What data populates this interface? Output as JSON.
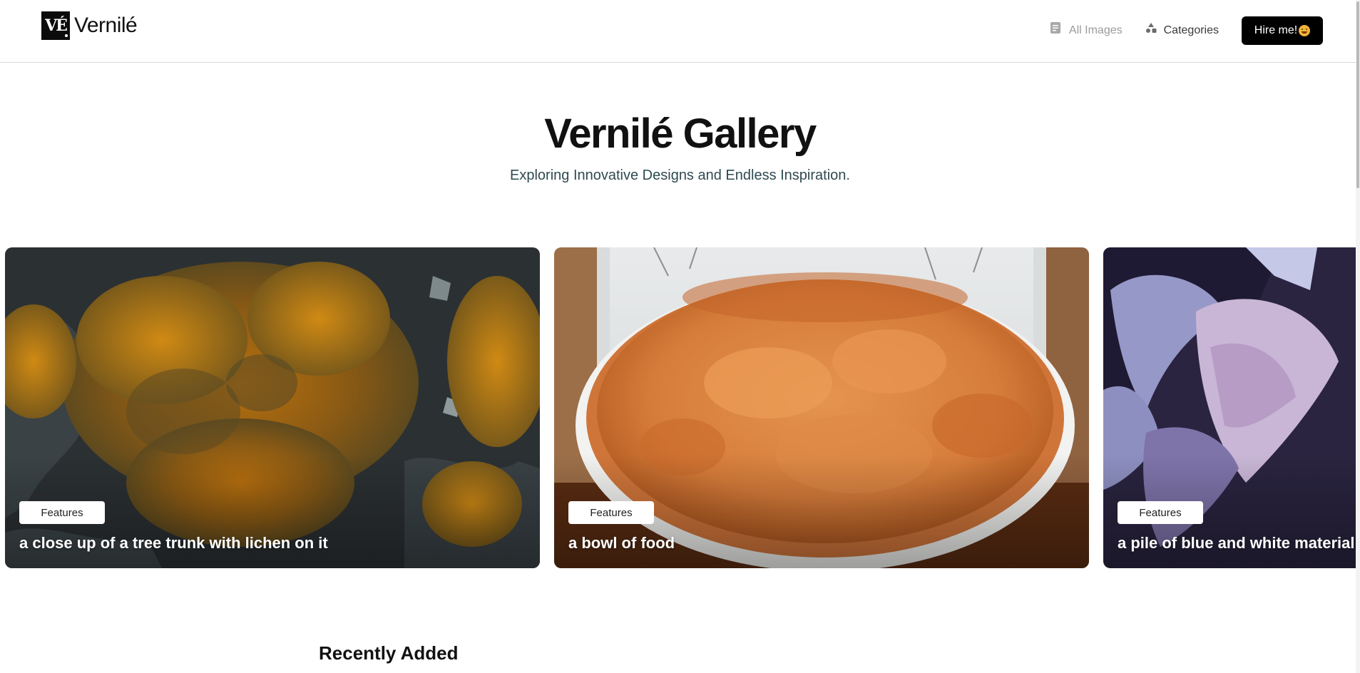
{
  "brand": {
    "logo_text": "VÉ",
    "name": "Vernilé"
  },
  "nav": {
    "all_images": {
      "label": "All Images",
      "icon": "document-icon"
    },
    "categories": {
      "label": "Categories",
      "icon": "shapes-icon"
    },
    "hire_button": {
      "label": "Hire me!",
      "icon": "smiley-emoji"
    }
  },
  "hero": {
    "title": "Vernilé Gallery",
    "subtitle": "Exploring Innovative Designs and Endless Inspiration."
  },
  "carousel": {
    "cards": [
      {
        "tag": "Features",
        "caption": "a close up of a tree trunk with lichen on it"
      },
      {
        "tag": "Features",
        "caption": "a bowl of food"
      },
      {
        "tag": "Features",
        "caption": "a pile of blue and white material"
      }
    ]
  },
  "recent": {
    "title": "Recently Added"
  },
  "colors": {
    "accent": "#000000",
    "subtitle": "#2f4a50",
    "muted_nav": "#9a9a9a"
  }
}
